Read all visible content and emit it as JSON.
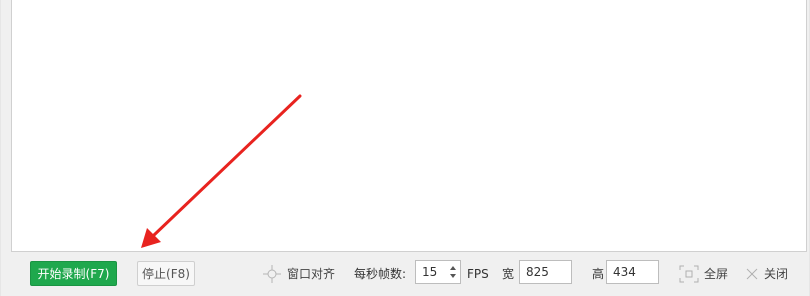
{
  "toolbar": {
    "start_label": "开始录制(F7)",
    "stop_label": "停止(F8)",
    "snap_label": "窗口对齐",
    "fps_label": "每秒帧数:",
    "fps_value": "15",
    "fps_unit": "FPS",
    "width_label": "宽",
    "width_value": "825",
    "height_label": "高",
    "height_value": "434",
    "fullscreen_label": "全屏",
    "close_label": "关闭"
  },
  "colors": {
    "start_button": "#1fa84d",
    "annotation_arrow": "#e8231f"
  },
  "icons": [
    "crosshair-icon",
    "spinner-icon",
    "fullscreen-icon",
    "close-icon",
    "arrow-annotation"
  ]
}
